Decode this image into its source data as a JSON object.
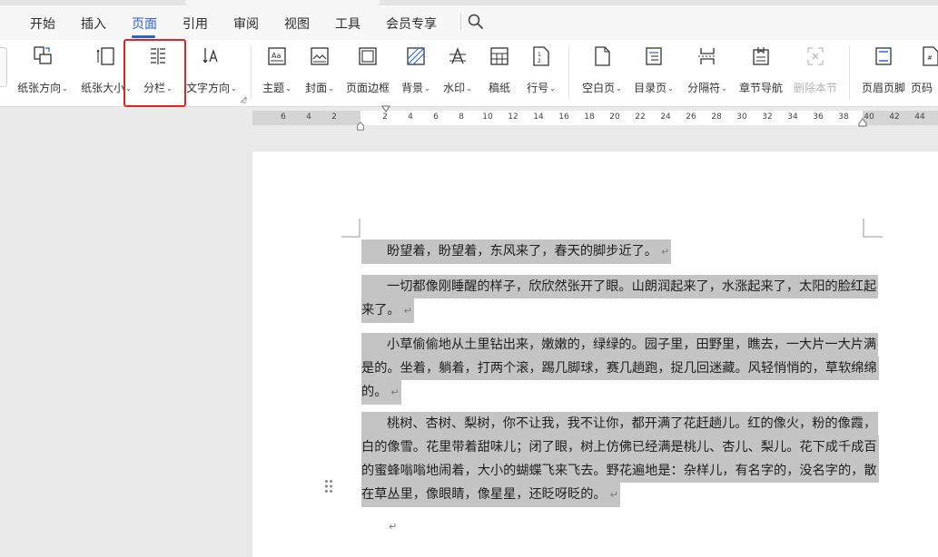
{
  "menu": {
    "tabs": [
      {
        "label": "开始"
      },
      {
        "label": "插入"
      },
      {
        "label": "页面"
      },
      {
        "label": "引用"
      },
      {
        "label": "审阅"
      },
      {
        "label": "视图"
      },
      {
        "label": "工具"
      },
      {
        "label": "会员专享"
      }
    ],
    "active_tab": "页面",
    "search_icon": "search-icon"
  },
  "ribbon": {
    "buttons": [
      {
        "label": "纸张方向",
        "icon": "page-orientation-icon",
        "dropdown": true
      },
      {
        "label": "纸张大小",
        "icon": "page-size-icon",
        "dropdown": true
      },
      {
        "label": "分栏",
        "icon": "columns-icon",
        "dropdown": true
      },
      {
        "label": "文字方向",
        "icon": "text-direction-icon",
        "dropdown": true
      },
      {
        "label": "主题",
        "icon": "theme-icon",
        "dropdown": true
      },
      {
        "label": "封面",
        "icon": "cover-icon",
        "dropdown": true
      },
      {
        "label": "页面边框",
        "icon": "page-border-icon",
        "dropdown": false
      },
      {
        "label": "背景",
        "icon": "background-icon",
        "dropdown": true
      },
      {
        "label": "水印",
        "icon": "watermark-icon",
        "dropdown": true
      },
      {
        "label": "稿纸",
        "icon": "manuscript-icon",
        "dropdown": false
      },
      {
        "label": "行号",
        "icon": "line-number-icon",
        "dropdown": true
      },
      {
        "label": "空白页",
        "icon": "blank-page-icon",
        "dropdown": true
      },
      {
        "label": "目录页",
        "icon": "toc-page-icon",
        "dropdown": true
      },
      {
        "label": "分隔符",
        "icon": "separator-icon",
        "dropdown": true
      },
      {
        "label": "章节导航",
        "icon": "section-nav-icon",
        "dropdown": false
      },
      {
        "label": "删除本节",
        "icon": "delete-section-icon",
        "dropdown": false,
        "disabled": true
      },
      {
        "label": "页眉页脚",
        "icon": "header-footer-icon",
        "dropdown": false
      },
      {
        "label": "页码",
        "icon": "page-number-icon",
        "dropdown": false
      }
    ]
  },
  "ruler": {
    "numbers": [
      "6",
      "4",
      "2",
      "2",
      "4",
      "6",
      "8",
      "10",
      "12",
      "14",
      "16",
      "18",
      "20",
      "22",
      "24",
      "26",
      "28",
      "30",
      "32",
      "34",
      "36",
      "38",
      "40",
      "42",
      "44"
    ]
  },
  "document": {
    "paragraph_mark": "↵",
    "paragraphs": [
      {
        "lines": [
          "盼望着，盼望着，东风来了，春天的脚步近了。"
        ]
      },
      {
        "lines": [
          "一切都像刚睡醒的样子，欣欣然张开了眼。山朗润起来了，水涨起来了，太阳的脸红起",
          "来了。"
        ]
      },
      {
        "lines": [
          "小草偷偷地从土里钻出来，嫩嫩的，绿绿的。园子里，田野里，瞧去，一大片一大片满",
          "是的。坐着，躺着，打两个滚，踢几脚球，赛几趟跑，捉几回迷藏。风轻悄悄的，草软绵绵",
          "的。"
        ]
      },
      {
        "lines": [
          "桃树、杏树、梨树，你不让我，我不让你，都开满了花赶趟儿。红的像火，粉的像霞，",
          "白的像雪。花里带着甜味儿；闭了眼，树上仿佛已经满是桃儿、杏儿、梨儿。花下成千成百",
          "的蜜蜂嗡嗡地闹着，大小的蝴蝶飞来飞去。野花遍地是：杂样儿，有名字的，没名字的，散",
          "在草丛里，像眼睛，像星星，还眨呀眨的。"
        ]
      },
      {
        "lines": [
          ""
        ]
      }
    ]
  },
  "colors": {
    "accent": "#2962d9",
    "highlight_box": "#e02424",
    "selection": "#c4c4c4"
  }
}
